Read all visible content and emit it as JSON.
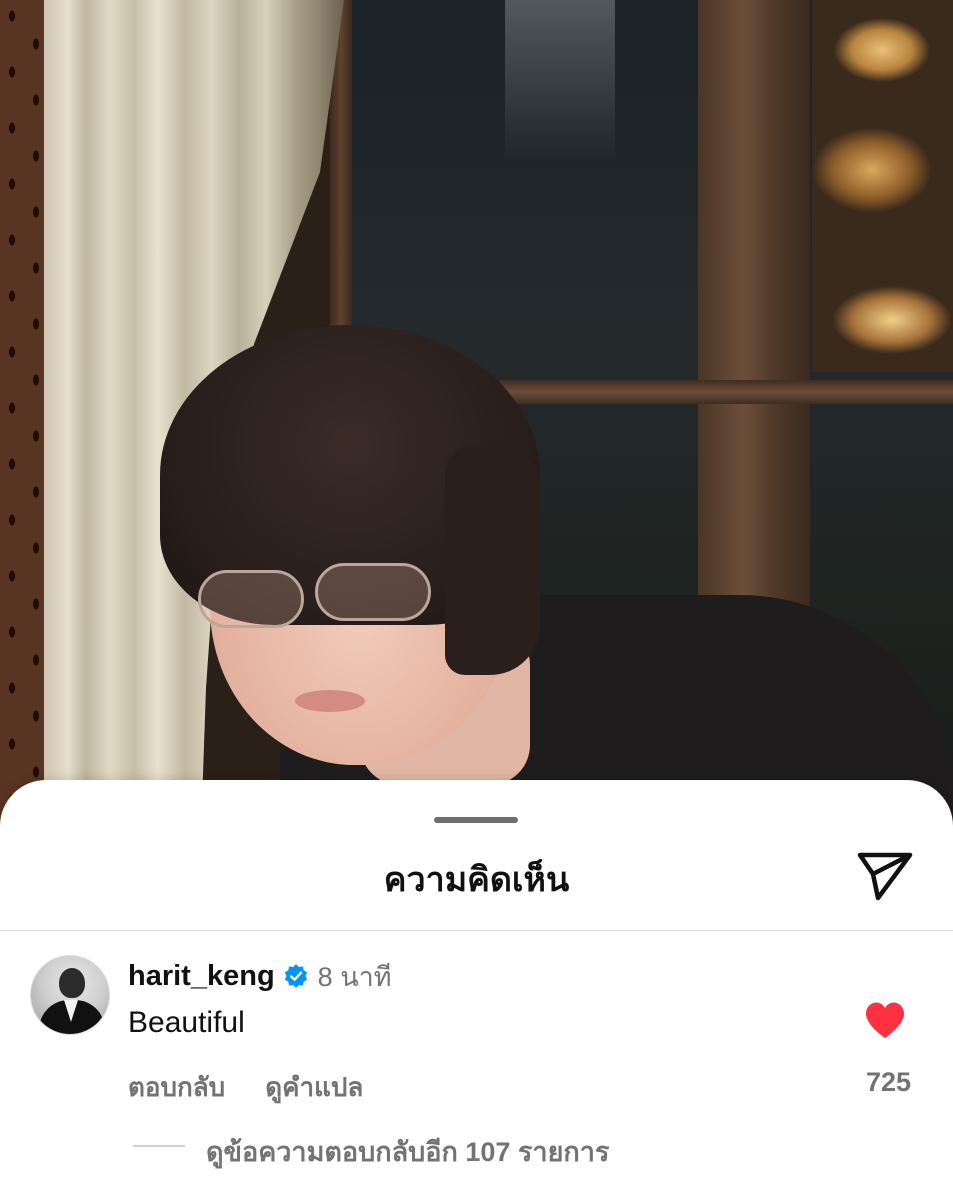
{
  "sheet": {
    "title": "ความคิดเห็น"
  },
  "comment": {
    "username": "harit_keng",
    "time": "8 นาที",
    "text": "Beautiful",
    "reply_label": "ตอบกลับ",
    "translate_label": "ดูคำแปล",
    "like_count": "725",
    "liked": true,
    "view_replies_label": "ดูข้อความตอบกลับอีก 107 รายการ"
  },
  "colors": {
    "heart": "#ff3040",
    "verified": "#0095f6",
    "secondary_text": "#737373",
    "primary_text": "#111111"
  },
  "icons": {
    "share": "paper-plane-icon",
    "verified": "verified-badge-icon",
    "like": "heart-filled-icon"
  }
}
